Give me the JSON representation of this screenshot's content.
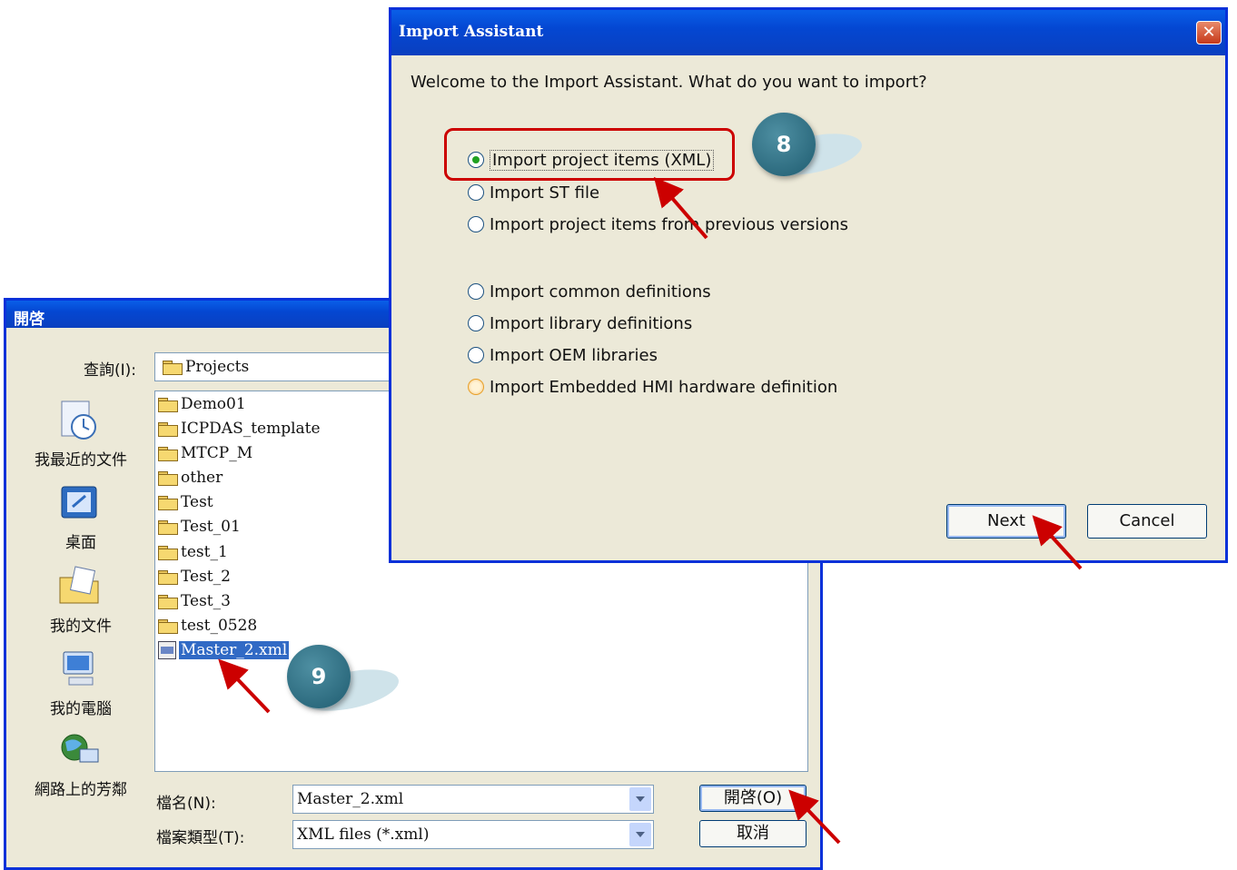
{
  "import_dialog": {
    "title": "Import Assistant",
    "close_glyph": "✕",
    "prompt": "Welcome to the Import Assistant. What do you want to import?",
    "options": [
      "Import project items (XML)",
      "Import ST file",
      "Import project items from previous versions",
      "Import common definitions",
      "Import library definitions",
      "Import OEM libraries",
      "Import Embedded HMI hardware definition"
    ],
    "selected_option": "Import project items (XML)",
    "next_label": "Next",
    "cancel_label": "Cancel"
  },
  "open_dialog": {
    "title": "開啓",
    "lookin_label": "查詢(I):",
    "lookin_value": "Projects",
    "places": [
      "我最近的文件",
      "桌面",
      "我的文件",
      "我的電腦",
      "網路上的芳鄰"
    ],
    "files": [
      "Demo01",
      "ICPDAS_template",
      "MTCP_M",
      "other",
      "Test",
      "Test_01",
      "test_1",
      "Test_2",
      "Test_3",
      "test_0528",
      "Master_2.xml"
    ],
    "selected_file": "Master_2.xml",
    "filename_label": "檔名(N):",
    "filename_value": "Master_2.xml",
    "filetype_label": "檔案類型(T):",
    "filetype_value": "XML files (*.xml)",
    "open_label": "開啓(O)",
    "cancel_label": "取消"
  },
  "callouts": {
    "step8": "8",
    "step9": "9"
  },
  "colors": {
    "titlebar": "#0447d2",
    "highlight": "#cc0000",
    "callout": "#2f6f82"
  }
}
